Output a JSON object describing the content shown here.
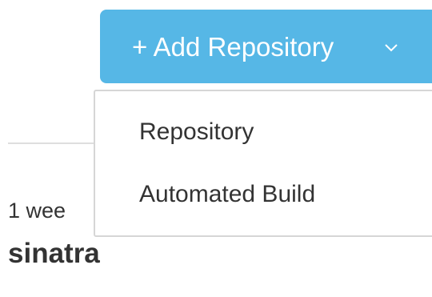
{
  "header": {
    "add_repository_label": "+ Add Repository",
    "dropdown_icon": "chevron-down-icon",
    "button_color": "#56b7e6"
  },
  "dropdown": {
    "items": [
      {
        "label": "Repository"
      },
      {
        "label": "Automated Build"
      }
    ]
  },
  "repo_list": {
    "time_ago": "1 wee",
    "name": "sinatra"
  }
}
